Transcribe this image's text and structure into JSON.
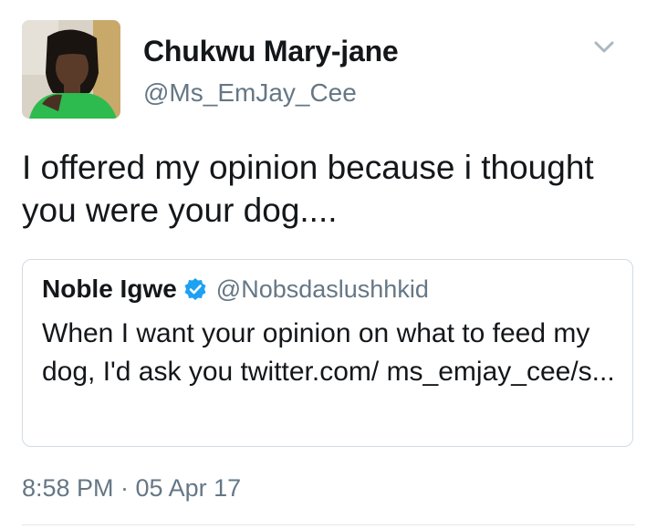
{
  "tweet": {
    "author": {
      "display_name": "Chukwu Mary-jane",
      "handle": "@Ms_EmJay_Cee"
    },
    "text": "I offered my opinion because i thought you were your dog....",
    "timestamp": "8:58 PM · 05 Apr 17"
  },
  "quoted_tweet": {
    "display_name": "Noble Igwe",
    "verified": true,
    "handle": "@Nobsdaslushhkid",
    "text": "When I want your opinion on what to feed my dog, I'd ask you twitter.com/ ms_emjay_cee/s..."
  },
  "icons": {
    "menu": "chevron-down-icon",
    "verified": "verified-badge-icon"
  },
  "colors": {
    "primary_text": "#14171a",
    "secondary_text": "#657786",
    "verified_blue": "#1da1f2",
    "border": "#d3dbe2"
  }
}
